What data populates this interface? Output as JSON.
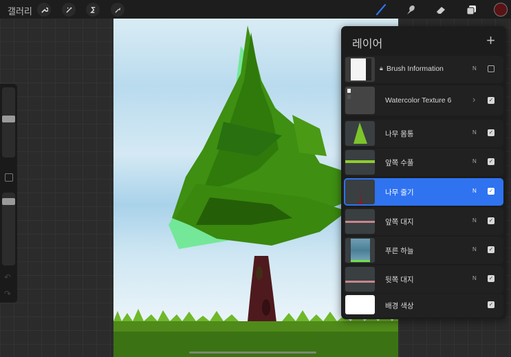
{
  "topbar": {
    "gallery_label": "갤러리",
    "left_tools": [
      {
        "name": "actions",
        "icon": "wrench-icon",
        "glyph": "🔧"
      },
      {
        "name": "adjustments",
        "icon": "magic-wand-icon",
        "glyph": "✦"
      },
      {
        "name": "selection",
        "icon": "selection-s-icon",
        "glyph": "S"
      },
      {
        "name": "transform",
        "icon": "arrow-cursor-icon",
        "glyph": "➚"
      }
    ],
    "right_tools": [
      {
        "name": "brush",
        "icon": "brush-icon",
        "active": true
      },
      {
        "name": "smudge",
        "icon": "smudge-icon",
        "active": false
      },
      {
        "name": "eraser",
        "icon": "eraser-icon",
        "active": false
      },
      {
        "name": "layers",
        "icon": "layers-icon",
        "active": true
      }
    ],
    "current_color": "#5a1215",
    "accent_color": "#2f73f0"
  },
  "sidebar": {
    "brush_size_level": 0.45,
    "opacity_level": 0.05,
    "undo_glyph": "↶",
    "redo_glyph": "↷"
  },
  "layers_panel": {
    "title": "레이어",
    "add_glyph": "+",
    "layers": [
      {
        "name": "Brush Information",
        "locked": true,
        "blend": "N",
        "visible": false,
        "active": false,
        "group": false
      },
      {
        "name": "Watercolor Texture 6",
        "locked": false,
        "blend": "",
        "visible": true,
        "active": false,
        "group": true
      },
      {
        "name": "나무 몸통",
        "locked": false,
        "blend": "N",
        "visible": true,
        "active": false,
        "group": false
      },
      {
        "name": "앞쪽 수풀",
        "locked": false,
        "blend": "N",
        "visible": true,
        "active": false,
        "group": false
      },
      {
        "name": "나무 줄기",
        "locked": false,
        "blend": "N",
        "visible": true,
        "active": true,
        "group": false
      },
      {
        "name": "앞쪽 대지",
        "locked": false,
        "blend": "N",
        "visible": true,
        "active": false,
        "group": false
      },
      {
        "name": "푸른 하늘",
        "locked": false,
        "blend": "N",
        "visible": true,
        "active": false,
        "group": false
      },
      {
        "name": "뒷쪽 대지",
        "locked": false,
        "blend": "N",
        "visible": true,
        "active": false,
        "group": false
      },
      {
        "name": "배경 색상",
        "locked": false,
        "blend": "",
        "visible": true,
        "active": false,
        "group": false
      }
    ]
  }
}
